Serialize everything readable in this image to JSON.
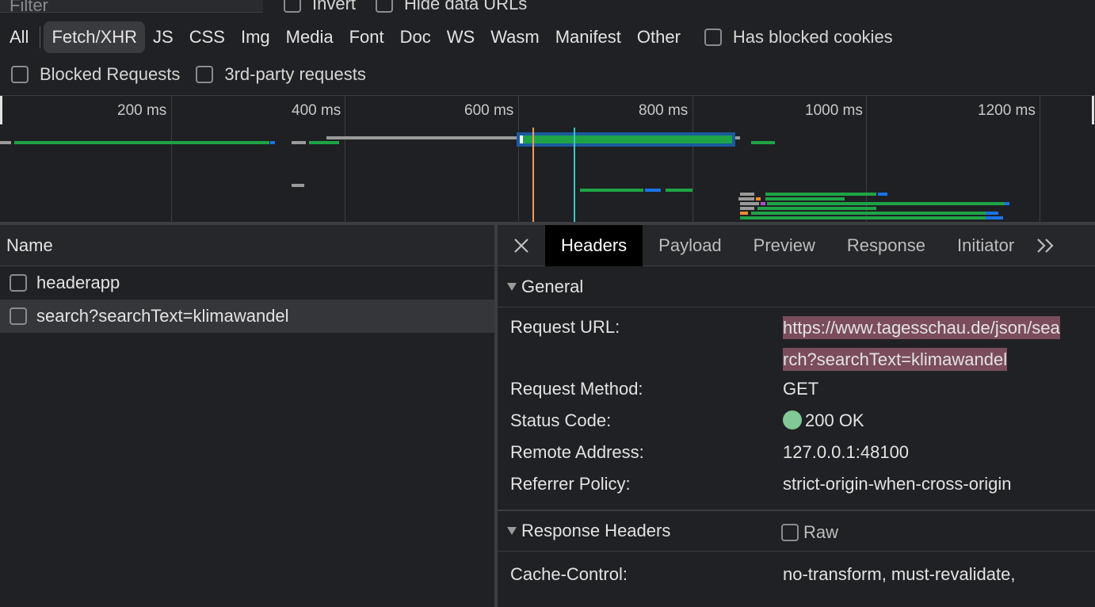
{
  "filter": {
    "placeholder": "Filter",
    "invert_label": "Invert",
    "hide_data_urls_label": "Hide data URLs"
  },
  "types": [
    {
      "label": "All"
    },
    {
      "label": "Fetch/XHR"
    },
    {
      "label": "JS"
    },
    {
      "label": "CSS"
    },
    {
      "label": "Img"
    },
    {
      "label": "Media"
    },
    {
      "label": "Font"
    },
    {
      "label": "Doc"
    },
    {
      "label": "WS"
    },
    {
      "label": "Wasm"
    },
    {
      "label": "Manifest"
    },
    {
      "label": "Other"
    }
  ],
  "active_type": "Fetch/XHR",
  "has_blocked_cookies_label": "Has blocked cookies",
  "blocked_requests_label": "Blocked Requests",
  "third_party_label": "3rd-party requests",
  "timeline": {
    "ticks": [
      "200 ms",
      "400 ms",
      "600 ms",
      "800 ms",
      "1000 ms",
      "1200 ms"
    ]
  },
  "list": {
    "header": "Name",
    "rows": [
      {
        "name": "headerapp"
      },
      {
        "name": "search?searchText=klimawandel"
      }
    ]
  },
  "details": {
    "tabs": [
      "Headers",
      "Payload",
      "Preview",
      "Response",
      "Initiator"
    ],
    "general_title": "General",
    "request_url_label": "Request URL:",
    "request_url_line1": "https://www.tagesschau.de/json/sea",
    "request_url_line2": "rch?searchText=klimawandel",
    "request_method_label": "Request Method:",
    "request_method": "GET",
    "status_code_label": "Status Code:",
    "status_code": "200 OK",
    "remote_address_label": "Remote Address:",
    "remote_address": "127.0.0.1:48100",
    "referrer_policy_label": "Referrer Policy:",
    "referrer_policy": "strict-origin-when-cross-origin",
    "response_headers_title": "Response Headers",
    "raw_label": "Raw",
    "cache_control_label": "Cache-Control:",
    "cache_control": "no-transform, must-revalidate,"
  },
  "colors": {
    "status_ok": "#81c995",
    "selection": "#7a4c5c",
    "active_tab_bg": "#000000"
  }
}
